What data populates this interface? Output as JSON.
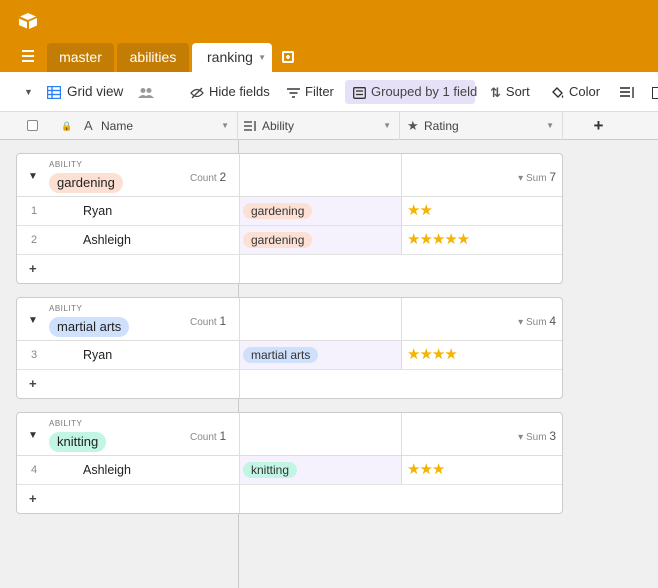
{
  "tabs": [
    {
      "label": "master"
    },
    {
      "label": "abilities"
    },
    {
      "label": "ranking"
    }
  ],
  "toolbar": {
    "view_label": "Grid view",
    "hide_fields": "Hide fields",
    "filter": "Filter",
    "grouped": "Grouped by 1 field",
    "sort": "Sort",
    "color": "Color"
  },
  "columns": [
    {
      "label": "Name"
    },
    {
      "label": "Ability"
    },
    {
      "label": "Rating"
    }
  ],
  "add_column": "+",
  "colors": {
    "brand": "#e08d00",
    "star": "#f5b400"
  },
  "groups": [
    {
      "field_label": "ABILITY",
      "value": "gardening",
      "pill_color": "#fde0d4",
      "count_label": "Count",
      "count": "2",
      "sum_label": "Sum",
      "sum": "7",
      "rows": [
        {
          "num": "1",
          "name": "Ryan",
          "ability": "gardening",
          "rating": 2
        },
        {
          "num": "2",
          "name": "Ashleigh",
          "ability": "gardening",
          "rating": 5
        }
      ],
      "add": "+"
    },
    {
      "field_label": "ABILITY",
      "value": "martial arts",
      "pill_color": "#cfe0fc",
      "count_label": "Count",
      "count": "1",
      "sum_label": "Sum",
      "sum": "4",
      "rows": [
        {
          "num": "3",
          "name": "Ryan",
          "ability": "martial arts",
          "rating": 4
        }
      ],
      "add": "+"
    },
    {
      "field_label": "ABILITY",
      "value": "knitting",
      "pill_color": "#c2f5e3",
      "count_label": "Count",
      "count": "1",
      "sum_label": "Sum",
      "sum": "3",
      "rows": [
        {
          "num": "4",
          "name": "Ashleigh",
          "ability": "knitting",
          "rating": 3
        }
      ],
      "add": "+"
    }
  ]
}
